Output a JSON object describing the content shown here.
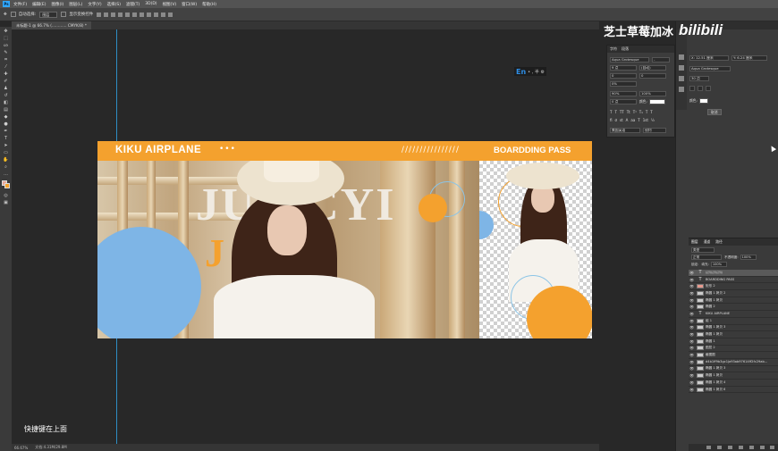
{
  "menubar": {
    "items": [
      "文件(F)",
      "编辑(E)",
      "图像(I)",
      "图层(L)",
      "文字(Y)",
      "选择(S)",
      "滤镜(T)",
      "3D(D)",
      "视图(V)",
      "窗口(W)",
      "帮助(H)"
    ]
  },
  "options_bar": {
    "auto_select_label": "自动选择:",
    "auto_select_value": "图层",
    "transform_label": "显示变换控件"
  },
  "document": {
    "tab_title": "未标题-1 @ 66.7% (………… CMYK/8) *"
  },
  "canvas": {
    "header": {
      "brand": "KIKU AIRPLANE",
      "dots": "•••",
      "slashes": "////////////////",
      "pass_label": "BOARDDING PASS"
    },
    "big_text": "JUN CYI",
    "orange_text": "J  H",
    "colors": {
      "orange": "#f4a12e",
      "blue": "#7eb5e6"
    }
  },
  "ime": {
    "lang": "En",
    "extra": "• , 半 ⚙"
  },
  "caption": "快捷键在上面",
  "statusbar": {
    "zoom": "66.67%",
    "doc_info": "文档:4.31M/29.8M"
  },
  "watermark": {
    "text": "芝士草莓加冰",
    "logo": "bilibili"
  },
  "character_panel": {
    "tabs": [
      "字符",
      "段落"
    ],
    "font_family": "Aqua Grotesque",
    "font_style": "-",
    "font_size": "9 点",
    "leading": "(自动)",
    "tracking": "0",
    "kerning": "0%",
    "vertical_scale": "90%",
    "horizontal_scale": "100%",
    "baseline": "0 点",
    "color_label": "颜色:",
    "format_glyphs": [
      "T",
      "T",
      "TT",
      "Tt",
      "T¹",
      "T₁",
      "T",
      "T"
    ],
    "ot_glyphs": [
      "fi",
      "ơ",
      "st",
      "A",
      "aa",
      "T",
      "1st",
      "½"
    ],
    "language": "美国英语",
    "aa": "锐利"
  },
  "right_mini_panel": {
    "x": "X: 12.51 厘米",
    "y": "Y: 6.24 厘米",
    "font": "Aqua Grotesque",
    "size": "30 点",
    "color_label": "颜色:",
    "cancel_label": "取消"
  },
  "layers_panel": {
    "tabs": [
      "图层",
      "通道",
      "路径"
    ],
    "kind_label": "类型",
    "blend_mode": "正常",
    "opacity_label": "不透明度:",
    "opacity_value": "100%",
    "lock_label": "锁定:",
    "fill_label": "填充:",
    "fill_value": "100%",
    "rows": [
      {
        "name": "////////////////",
        "type": "text",
        "selected": true
      },
      {
        "name": "BOARDDING PASS",
        "type": "text"
      },
      {
        "name": "矩形 2",
        "type": "pink"
      },
      {
        "name": "椭圆 1 拷贝 2",
        "type": "shape"
      },
      {
        "name": "椭圆 1 拷贝",
        "type": "shape"
      },
      {
        "name": "椭圆 2",
        "type": "shape"
      },
      {
        "name": "KIKU AIRPLANE",
        "type": "text"
      },
      {
        "name": "组 1",
        "type": "group"
      },
      {
        "name": "椭圆 1 拷贝 3",
        "type": "shape"
      },
      {
        "name": "椭圆 1 拷贝",
        "type": "shape"
      },
      {
        "name": "椭圆 1",
        "type": "shape"
      },
      {
        "name": "图层 2",
        "type": "shape"
      },
      {
        "name": "截图图",
        "type": "shape"
      },
      {
        "name": "d4b1ff9b3gc1ja93ab97614ff2fc29ab...",
        "type": "shape"
      },
      {
        "name": "椭圆 1 拷贝 3",
        "type": "shape"
      },
      {
        "name": "椭圆 1 拷贝",
        "type": "shape"
      },
      {
        "name": "椭圆 1 拷贝 4",
        "type": "shape"
      },
      {
        "name": "椭圆 1 拷贝 6",
        "type": "shape"
      }
    ]
  }
}
